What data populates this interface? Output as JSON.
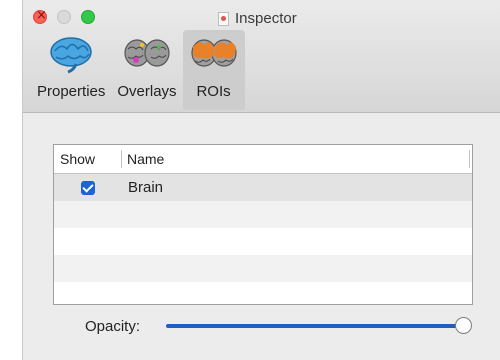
{
  "window": {
    "title": "Inspector"
  },
  "toolbar": {
    "tabs": [
      {
        "label": "Properties",
        "icon": "brain-blue-icon",
        "active": false
      },
      {
        "label": "Overlays",
        "icon": "brain-overlay-icon",
        "active": false
      },
      {
        "label": "ROIs",
        "icon": "brain-roi-icon",
        "active": true
      }
    ]
  },
  "roi_table": {
    "columns": [
      "Show",
      "Name"
    ],
    "rows": [
      {
        "show": true,
        "name": "Brain"
      }
    ]
  },
  "opacity": {
    "label": "Opacity:",
    "value": 1.0
  },
  "colors": {
    "accent": "#1f5fc4",
    "close": "#fc5f57",
    "maximize": "#34c84a",
    "roi_orange": "#e8822a",
    "brain_blue": "#3a9ad9"
  }
}
